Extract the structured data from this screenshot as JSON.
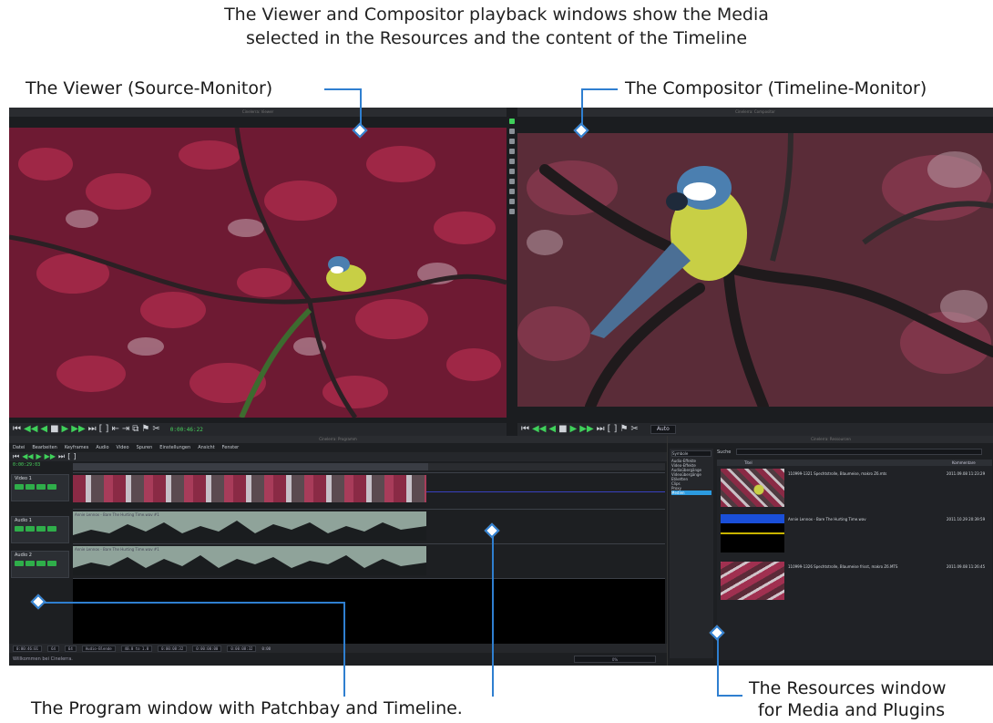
{
  "headline": {
    "line1": "The Viewer and Compositor playback windows show the Media",
    "line2": "selected in the Resources and the content of the Timeline"
  },
  "callouts": {
    "viewer": "The Viewer (Source-Monitor)",
    "compositor": "The Compositor (Timeline-Monitor)",
    "program": "The Program window with Patchbay and Timeline.",
    "resources_line1": "The Resources window",
    "resources_line2": "for Media and Plugins"
  },
  "colors": {
    "accent": "#2f7fd0",
    "transport_green": "#3fd05a",
    "foliage_red": "#9b2340",
    "bird_yellow": "#c8cf45",
    "bird_blue": "#4b7fb0"
  },
  "viewer": {
    "window_title": "Cinelerra: Viewer",
    "timecode": "0:00:46:22",
    "transport_icons": [
      "skip-start-icon",
      "rewind-icon",
      "play-reverse-icon",
      "stop-icon",
      "play-icon",
      "fast-forward-icon",
      "skip-end-icon",
      "in-point-icon",
      "out-point-icon",
      "splice-icon",
      "overwrite-icon",
      "copy-icon",
      "label-icon",
      "clip-icon"
    ]
  },
  "compositor": {
    "window_title": "Cinelerra: Compositor",
    "zoom": "Auto",
    "tool_icons": [
      "protect-icon",
      "zoom-icon",
      "mask-icon",
      "camera-icon",
      "projector-icon",
      "crop-icon",
      "eyedrop-icon",
      "ruler-icon",
      "tool-info-icon",
      "safe-region-icon"
    ]
  },
  "program": {
    "window_title": "Cinelerra: Programm",
    "menus": [
      "Datei",
      "Bearbeiten",
      "Keyframes",
      "Audio",
      "Video",
      "Spuren",
      "Einstellungen",
      "Ansicht",
      "Fenster"
    ],
    "timecode": "0:00:29:03",
    "tracks": [
      {
        "name": "Video 1",
        "type": "video"
      },
      {
        "name": "Audio 1",
        "type": "audio",
        "clip": "Annie Lennox - Bare The Hurting Time.wav #1"
      },
      {
        "name": "Audio 2",
        "type": "audio",
        "clip": "Annie Lennox - Bare The Hurting Time.wav #1"
      }
    ],
    "bottom_fields": [
      "0:00:46:01",
      "64",
      "64",
      "Audio-Blende",
      "40.0 to 1.0",
      "0:00:08:32",
      "0:00:00:00",
      "0:00:08:32",
      "0:00"
    ],
    "status": "Willkommen bei Cinelerra.",
    "zoom_percent": "0%"
  },
  "resources": {
    "window_title": "Cinelerra: Ressourcen",
    "view_mode": "Symbole",
    "folders": [
      "Audio-Effekte",
      "Video-Effekte",
      "Audioübergänge",
      "Videoübergänge",
      "Etiketten",
      "Clips",
      "Proxy",
      "Medien"
    ],
    "active_folder": "Medien",
    "search_label": "Suche",
    "columns": [
      "Titel",
      "Kommentare"
    ],
    "items": [
      {
        "title": "110999-1321 Spechtstrolle, Blaumeise, makro Z6.mts",
        "date": "2011.09.08 11:23:29"
      },
      {
        "title": "Annie Lennox - Bare The Hurting Time.wav",
        "date": "2011.10.29 20:39:59"
      },
      {
        "title": "110999-1326 Spechtstrolle, Blaumeise frisst, makro Z6.MTS",
        "date": "2011.09.08 11:26:45"
      }
    ]
  }
}
